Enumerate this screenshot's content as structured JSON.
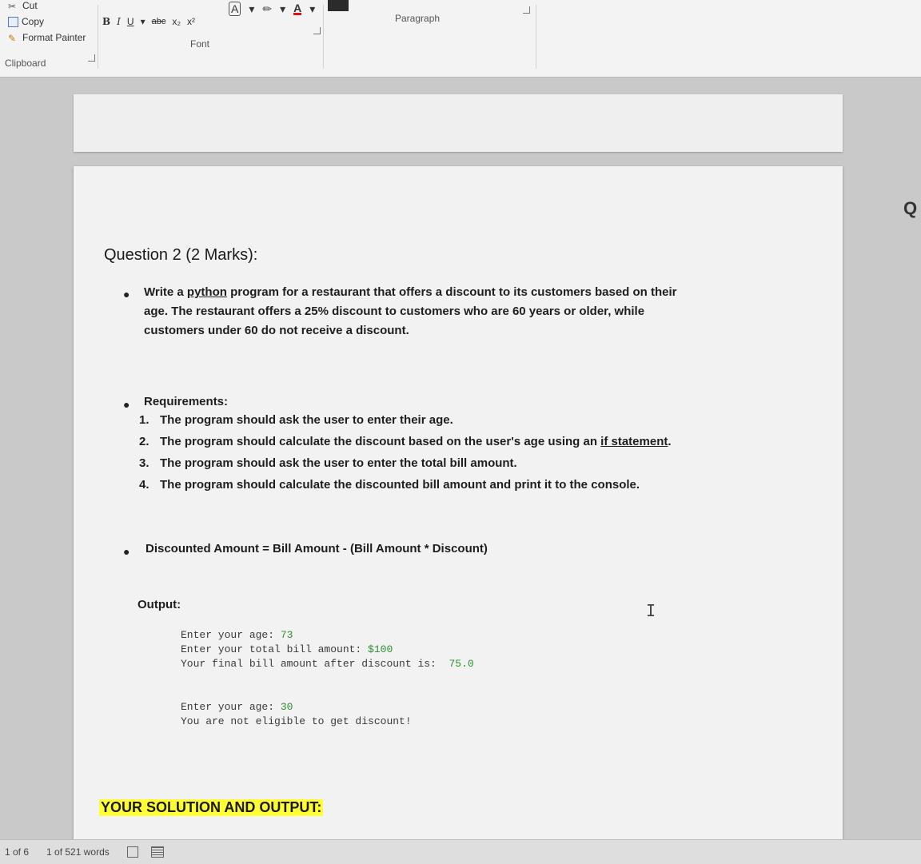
{
  "ribbon": {
    "clipboard": {
      "cut_label": "Cut",
      "copy_label": "Copy",
      "format_painter_label": "Format Painter",
      "group_label": "Clipboard"
    },
    "font": {
      "bold": "B",
      "italic": "I",
      "underline": "U",
      "strikethrough": "abc",
      "subscript": "x₂",
      "superscript": "x²",
      "group_label": "Font"
    },
    "paragraph": {
      "group_label": "Paragraph"
    }
  },
  "document": {
    "question_title": "Question 2 (2 Marks):",
    "intro": {
      "prefix": "Write a ",
      "link_word": "python",
      "line1_rest": " program for a restaurant that offers a discount to its customers based on their",
      "line2": "age. The restaurant offers a 25% discount to customers who are 60 years or older, while",
      "line3": "customers under 60 do not receive a discount."
    },
    "requirements_title": "Requirements:",
    "requirements": [
      {
        "num": "1.",
        "text": "The program should ask the user to enter their age.",
        "ul": ""
      },
      {
        "num": "2.",
        "text": "The program should calculate the discount based on the user's age using an ",
        "ul": "if statement",
        "after": "."
      },
      {
        "num": "3.",
        "text": "The program should ask the user to enter the total bill amount.",
        "ul": ""
      },
      {
        "num": "4.",
        "text": "The program should calculate the discounted bill amount and print it to the console.",
        "ul": ""
      }
    ],
    "formula": "Discounted Amount = Bill Amount - (Bill Amount * Discount)",
    "output_label": "Output:",
    "console1": {
      "line1_prompt": "Enter your age: ",
      "line1_value": "73",
      "line2_prompt": "Enter your total bill amount: ",
      "line2_value": "$100",
      "line3_prompt": "Your final bill amount after discount is:  ",
      "line3_value": "75.0"
    },
    "console2": {
      "line1_prompt": "Enter your age: ",
      "line1_value": "30",
      "line2": "You are not eligible to get discount!"
    },
    "solution_heading": "YOUR SOLUTION AND OUTPUT:",
    "edge_letter": "Q"
  },
  "status": {
    "page": "1 of 6",
    "words": "1 of 521 words"
  }
}
